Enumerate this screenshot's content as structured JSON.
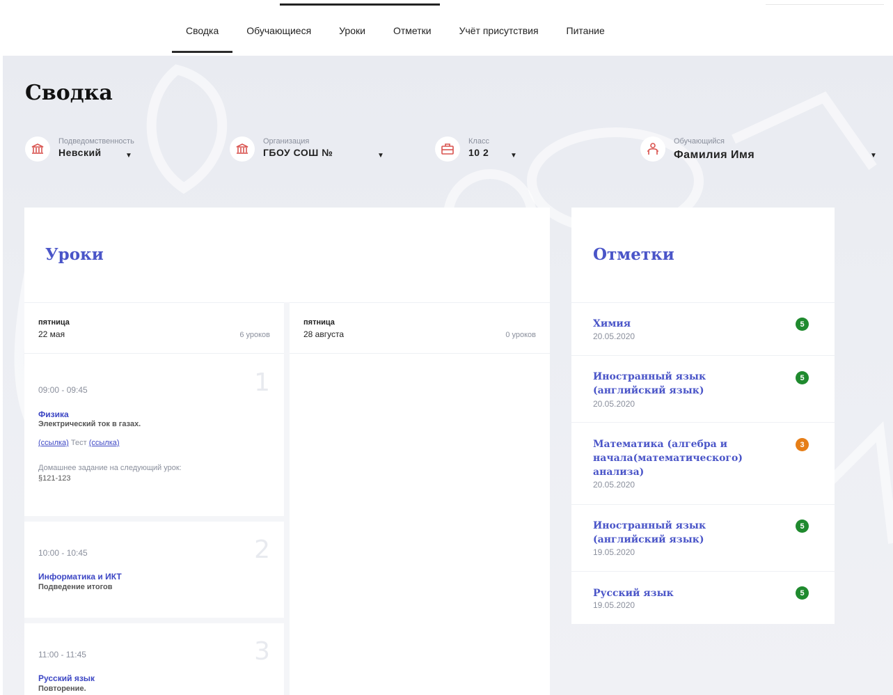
{
  "nav": {
    "tabs": [
      {
        "label": "Сводка"
      },
      {
        "label": "Обучающиеся"
      },
      {
        "label": "Уроки"
      },
      {
        "label": "Отметки"
      },
      {
        "label": "Учёт присутствия"
      },
      {
        "label": "Питание"
      }
    ]
  },
  "page_title": "Сводка",
  "filters": {
    "district": {
      "caption": "Подведомственность",
      "value": "Невский"
    },
    "organization": {
      "caption": "Организация",
      "value": "ГБОУ СОШ №"
    },
    "class": {
      "caption": "Класс",
      "value": "10 2"
    },
    "student": {
      "caption": "Обучающийся",
      "value": "Фамилия Имя"
    }
  },
  "lessons": {
    "title": "Уроки",
    "days": [
      {
        "weekday": "пятница",
        "date": "22 мая",
        "count": "6 уроков"
      },
      {
        "weekday": "пятница",
        "date": "28 августа",
        "count": "0 уроков"
      }
    ],
    "items": [
      {
        "number": "1",
        "time": "09:00 - 09:45",
        "subject": "Физика",
        "topic": "Электрический ток в газах.",
        "link1": "(ссылка)",
        "link_mid": " Тест ",
        "link2": "(ссылка)",
        "hw_label": "Домашнее задание на следующий урок:",
        "hw": "§121-123"
      },
      {
        "number": "2",
        "time": "10:00 - 10:45",
        "subject": "Информатика и ИКТ",
        "topic": "Подведение итогов"
      },
      {
        "number": "3",
        "time": "11:00 - 11:45",
        "subject": "Русский язык",
        "topic": "Повторение."
      }
    ]
  },
  "marks": {
    "title": "Отметки",
    "items": [
      {
        "subject": "Химия",
        "date": "20.05.2020",
        "mark": "5",
        "color": "#1f8a2e"
      },
      {
        "subject": "Иностранный язык (английский язык)",
        "date": "20.05.2020",
        "mark": "5",
        "color": "#1f8a2e"
      },
      {
        "subject": "Математика (алгебра и начала(математического) анализа)",
        "date": "20.05.2020",
        "mark": "3",
        "color": "#e67e17"
      },
      {
        "subject": "Иностранный язык (английский язык)",
        "date": "19.05.2020",
        "mark": "5",
        "color": "#1f8a2e"
      },
      {
        "subject": "Русский язык",
        "date": "19.05.2020",
        "mark": "5",
        "color": "#1f8a2e"
      }
    ]
  },
  "icons": {
    "district": "bank-building-icon",
    "organization": "bank-building-icon",
    "class": "briefcase-icon",
    "student": "person-icon",
    "caret": "caret-down-icon"
  },
  "colors": {
    "accent": "#4a55c8",
    "link": "#3c46c4",
    "icon": "#d9534f",
    "mark_good": "#1f8a2e",
    "mark_mid": "#e67e17"
  }
}
